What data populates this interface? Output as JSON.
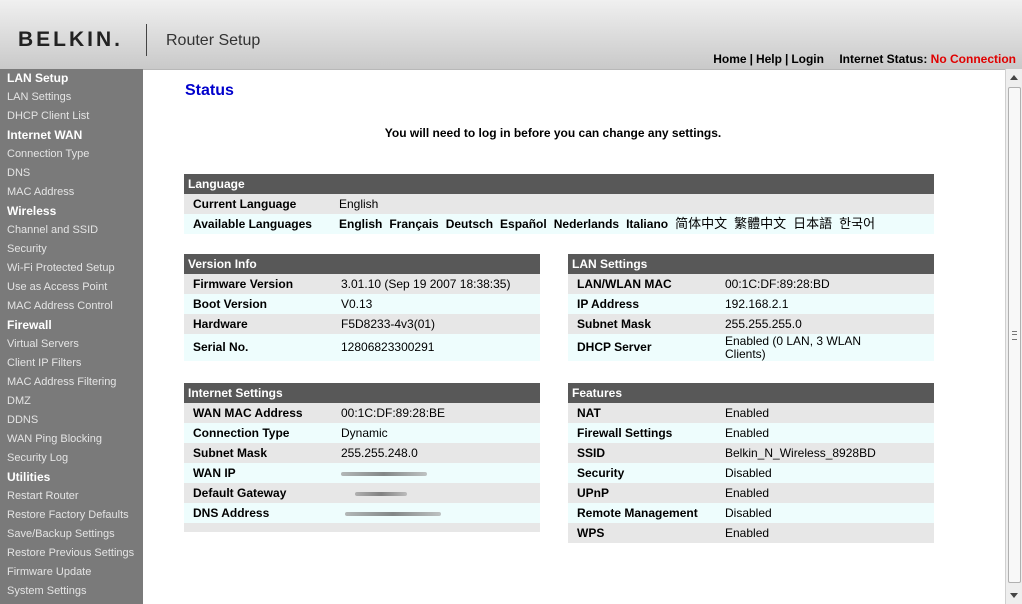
{
  "header": {
    "logo": "BELKIN.",
    "app_title": "Router Setup",
    "links": {
      "home": "Home",
      "sep": "|",
      "help": "Help",
      "login": "Login",
      "internet_status_label": "Internet Status:",
      "internet_status_value": "No Connection"
    }
  },
  "sidebar": [
    {
      "heading": "LAN Setup",
      "items": [
        "LAN Settings",
        "DHCP Client List"
      ]
    },
    {
      "heading": "Internet WAN",
      "items": [
        "Connection Type",
        "DNS",
        "MAC Address"
      ]
    },
    {
      "heading": "Wireless",
      "items": [
        "Channel and SSID",
        "Security",
        "Wi-Fi Protected Setup",
        "Use as Access Point",
        "MAC Address Control"
      ]
    },
    {
      "heading": "Firewall",
      "items": [
        "Virtual Servers",
        "Client IP Filters",
        "MAC Address Filtering",
        "DMZ",
        "DDNS",
        "WAN Ping Blocking",
        "Security Log"
      ]
    },
    {
      "heading": "Utilities",
      "items": [
        "Restart Router",
        "Restore Factory Defaults",
        "Save/Backup Settings",
        "Restore Previous Settings",
        "Firmware Update",
        "System Settings"
      ]
    }
  ],
  "main": {
    "title": "Status",
    "login_message": "You will need to log in before you can change any settings.",
    "language": {
      "header": "Language",
      "current_label": "Current Language",
      "current_value": "English",
      "available_label": "Available Languages",
      "available": [
        "English",
        "Français",
        "Deutsch",
        "Español",
        "Nederlands",
        "Italiano",
        "简体中文",
        "繁體中文",
        "日本語",
        "한국어"
      ]
    },
    "version_info": {
      "header": "Version Info",
      "rows": [
        {
          "label": "Firmware Version",
          "value": "3.01.10 (Sep 19 2007 18:38:35)"
        },
        {
          "label": "Boot Version",
          "value": "V0.13"
        },
        {
          "label": "Hardware",
          "value": "F5D8233-4v3(01)"
        },
        {
          "label": "Serial No.",
          "value": "12806823300291"
        }
      ]
    },
    "lan_settings": {
      "header": "LAN Settings",
      "rows": [
        {
          "label": "LAN/WLAN MAC",
          "value": "00:1C:DF:89:28:BD"
        },
        {
          "label": "IP Address",
          "value": "192.168.2.1"
        },
        {
          "label": "Subnet Mask",
          "value": "255.255.255.0"
        },
        {
          "label": "DHCP Server",
          "value": "Enabled (0 LAN, 3 WLAN",
          "value2": "Clients)"
        }
      ]
    },
    "internet_settings": {
      "header": "Internet Settings",
      "rows": [
        {
          "label": "WAN MAC Address",
          "value": "00:1C:DF:89:28:BE"
        },
        {
          "label": "Connection Type",
          "value": "Dynamic"
        },
        {
          "label": "Subnet Mask",
          "value": "255.255.248.0"
        },
        {
          "label": "WAN IP",
          "value": ""
        },
        {
          "label": "Default Gateway",
          "value": ""
        },
        {
          "label": "DNS Address",
          "value": ""
        }
      ]
    },
    "features": {
      "header": "Features",
      "rows": [
        {
          "label": "NAT",
          "value": "Enabled"
        },
        {
          "label": "Firewall Settings",
          "value": "Enabled"
        },
        {
          "label": "SSID",
          "value": "Belkin_N_Wireless_8928BD"
        },
        {
          "label": "Security",
          "value": "Disabled"
        },
        {
          "label": "UPnP",
          "value": "Enabled"
        },
        {
          "label": "Remote Management",
          "value": "Disabled"
        },
        {
          "label": "WPS",
          "value": "Enabled"
        }
      ]
    }
  },
  "colors": {
    "accent_title": "#0000cc",
    "status_red": "#e00000",
    "panel_header": "#585858",
    "sidebar_bg": "#7a7a7a"
  }
}
